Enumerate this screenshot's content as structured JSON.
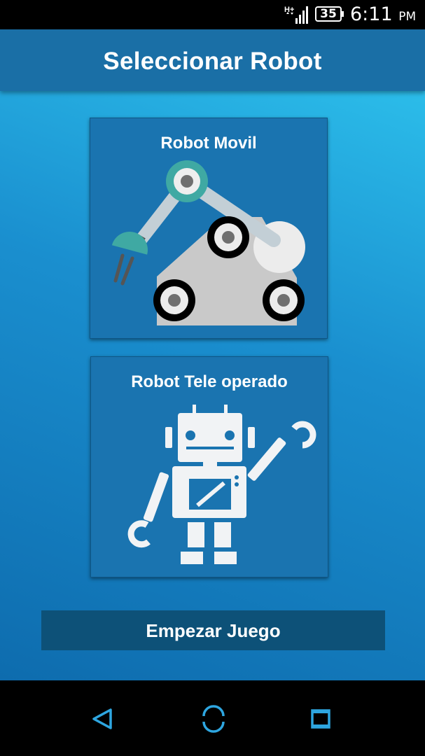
{
  "status_bar": {
    "battery_level": "35",
    "time": "6:11",
    "ampm": "PM"
  },
  "app_bar": {
    "title": "Seleccionar Robot"
  },
  "robots": [
    {
      "label": "Robot Movil",
      "icon": "mobile-robot-arm-icon"
    },
    {
      "label": "Robot Tele operado",
      "icon": "teleoperated-robot-icon"
    }
  ],
  "start_button": {
    "label": "Empezar Juego"
  },
  "nav_bar": {
    "back_icon": "back-triangle-icon",
    "home_icon": "home-circle-icon",
    "recent_icon": "recent-apps-square-icon"
  },
  "colors": {
    "accent": "#2ea6e0",
    "app_bar": "#1a6fa6",
    "card": "#1a74b0",
    "button": "#0d5178"
  }
}
